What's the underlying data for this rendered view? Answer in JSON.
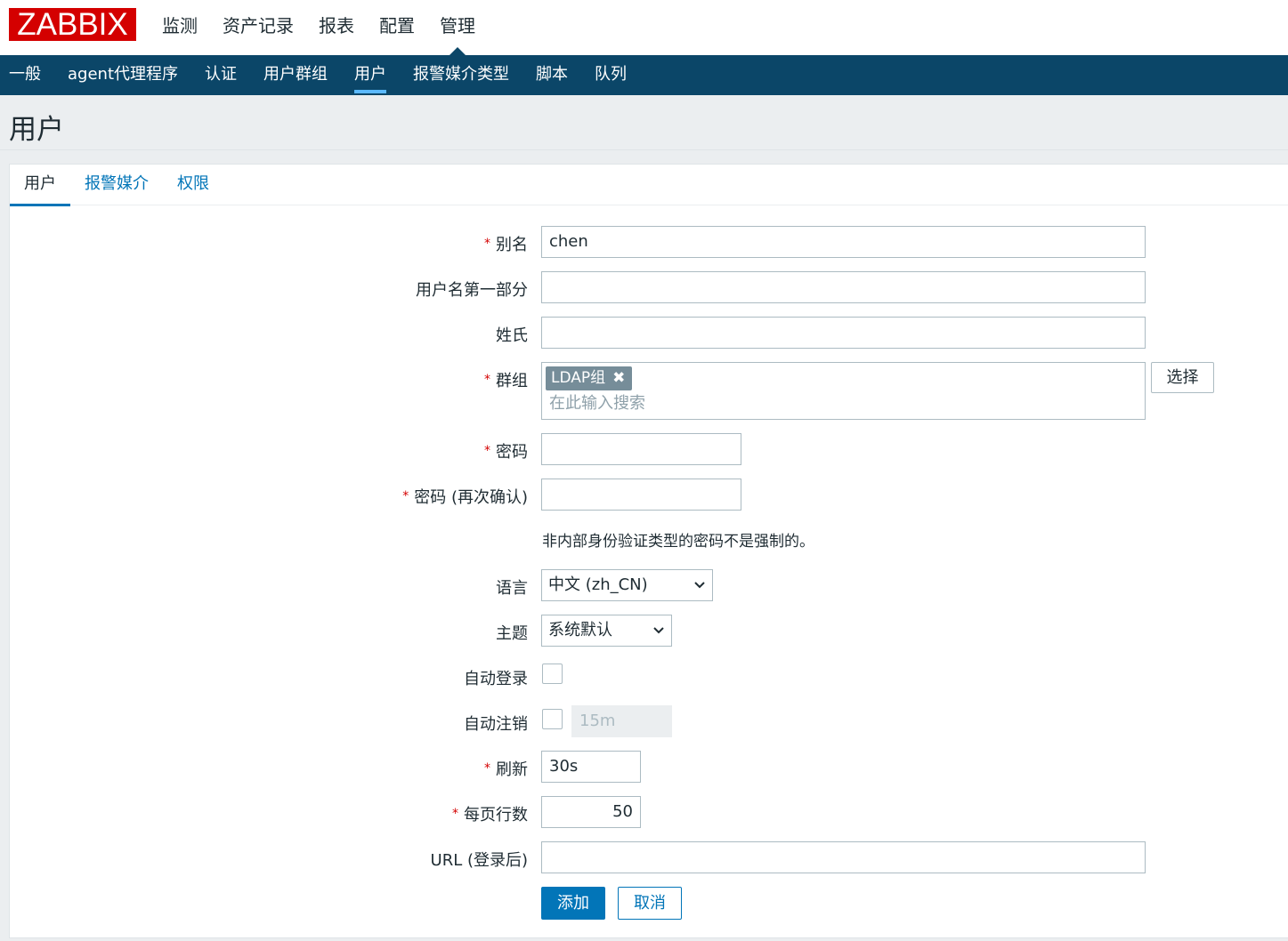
{
  "app": {
    "logo_text": "ZABBIX"
  },
  "main_menu": [
    {
      "label": "监测",
      "selected": false
    },
    {
      "label": "资产记录",
      "selected": false
    },
    {
      "label": "报表",
      "selected": false
    },
    {
      "label": "配置",
      "selected": false
    },
    {
      "label": "管理",
      "selected": true
    }
  ],
  "sub_menu": [
    {
      "label": "一般",
      "selected": false
    },
    {
      "label": "agent代理程序",
      "selected": false
    },
    {
      "label": "认证",
      "selected": false
    },
    {
      "label": "用户群组",
      "selected": false
    },
    {
      "label": "用户",
      "selected": true
    },
    {
      "label": "报警媒介类型",
      "selected": false
    },
    {
      "label": "脚本",
      "selected": false
    },
    {
      "label": "队列",
      "selected": false
    }
  ],
  "page": {
    "title": "用户"
  },
  "tabs": [
    {
      "label": "用户",
      "active": true
    },
    {
      "label": "报警媒介",
      "active": false
    },
    {
      "label": "权限",
      "active": false
    }
  ],
  "form": {
    "required_mark": "*",
    "alias": {
      "label": "别名",
      "value": "chen"
    },
    "first_name": {
      "label": "用户名第一部分",
      "value": ""
    },
    "surname": {
      "label": "姓氏",
      "value": ""
    },
    "groups": {
      "label": "群组",
      "selected_group": "LDAP组",
      "remove_icon": "✖",
      "placeholder": "在此输入搜索",
      "select_button": "选择"
    },
    "password": {
      "label": "密码",
      "value": ""
    },
    "password_confirm": {
      "label": "密码 (再次确认)",
      "value": ""
    },
    "password_note": "非内部身份验证类型的密码不是强制的。",
    "language": {
      "label": "语言",
      "value": "中文 (zh_CN)"
    },
    "theme": {
      "label": "主题",
      "value": "系统默认"
    },
    "autologin": {
      "label": "自动登录",
      "checked": false
    },
    "autologout": {
      "label": "自动注销",
      "checked": false,
      "value": "15m"
    },
    "refresh": {
      "label": "刷新",
      "value": "30s"
    },
    "rows_per_page": {
      "label": "每页行数",
      "value": "50"
    },
    "url": {
      "label": "URL (登录后)",
      "value": ""
    },
    "buttons": {
      "add": "添加",
      "cancel": "取消"
    }
  },
  "colors": {
    "brand_red": "#d40000",
    "nav_blue": "#0b4668",
    "accent_blue": "#0275b8",
    "chip_gray": "#768d99"
  }
}
